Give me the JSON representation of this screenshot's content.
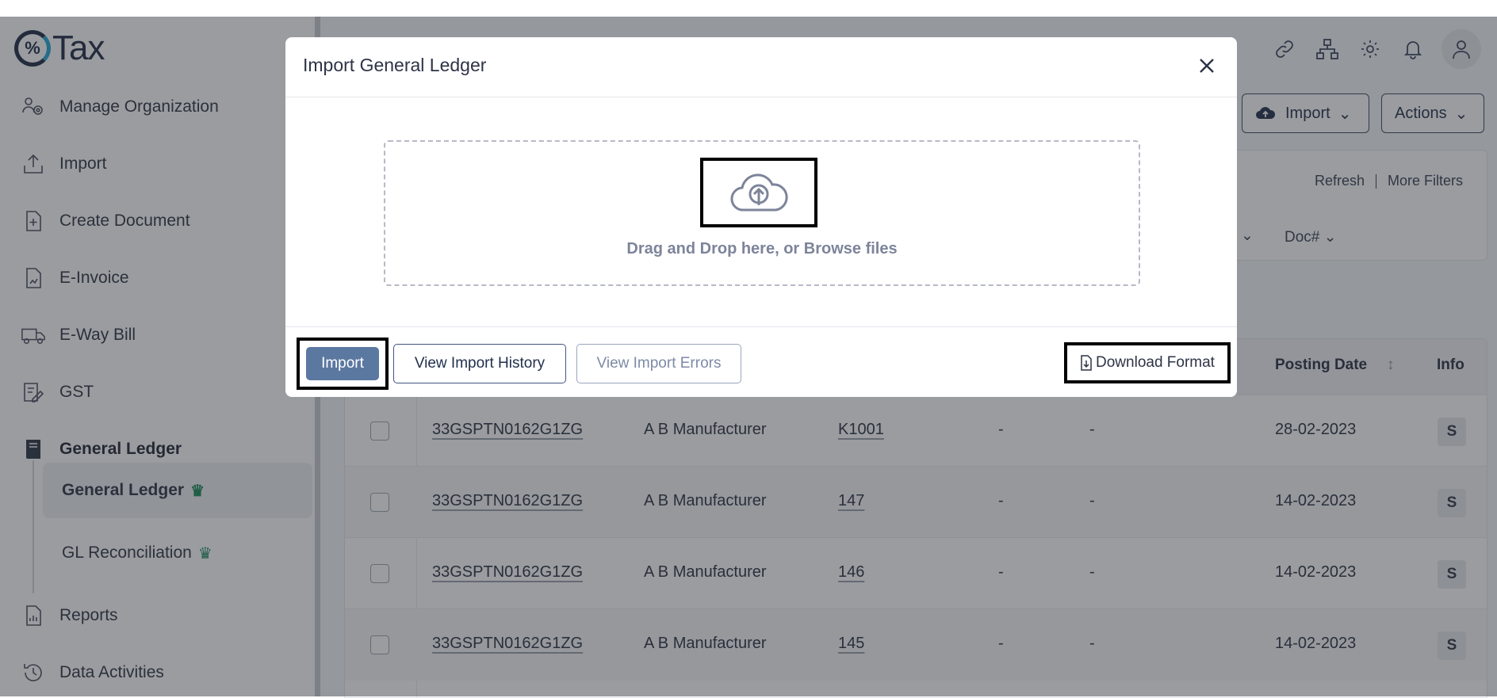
{
  "app": {
    "logo_symbol": "%",
    "logo_text": "Tax"
  },
  "sidebar": {
    "items": [
      {
        "label": "Manage Organization",
        "icon": "organization-icon"
      },
      {
        "label": "Import",
        "icon": "upload-icon"
      },
      {
        "label": "Create Document",
        "icon": "document-plus-icon"
      },
      {
        "label": "E-Invoice",
        "icon": "invoice-icon"
      },
      {
        "label": "E-Way Bill",
        "icon": "truck-icon"
      },
      {
        "label": "GST",
        "icon": "gst-icon"
      },
      {
        "label": "General Ledger",
        "icon": "book-icon"
      },
      {
        "label": "Reports",
        "icon": "report-icon"
      },
      {
        "label": "Data Activities",
        "icon": "history-icon"
      }
    ],
    "sub_items": [
      {
        "label": "General Ledger",
        "badge_icon": "crown-icon"
      },
      {
        "label": "GL Reconciliation",
        "badge_icon": "crown-icon"
      }
    ]
  },
  "toolbar": {
    "import_label": "Import",
    "actions_label": "Actions"
  },
  "filters": {
    "refresh": "Refresh",
    "more_filters": "More Filters",
    "doc_filter": "Doc#"
  },
  "table": {
    "headers": {
      "posting_date": "Posting Date",
      "info": "Info"
    },
    "rows": [
      {
        "gstin": "33GSPTN0162G1ZG",
        "party": "A B Manufacturer",
        "doc": "K1001",
        "c1": "-",
        "c2": "-",
        "date": "28-02-2023",
        "info": "S"
      },
      {
        "gstin": "33GSPTN0162G1ZG",
        "party": "A B Manufacturer",
        "doc": "147",
        "c1": "-",
        "c2": "-",
        "date": "14-02-2023",
        "info": "S"
      },
      {
        "gstin": "33GSPTN0162G1ZG",
        "party": "A B Manufacturer",
        "doc": "146",
        "c1": "-",
        "c2": "-",
        "date": "14-02-2023",
        "info": "S"
      },
      {
        "gstin": "33GSPTN0162G1ZG",
        "party": "A B Manufacturer",
        "doc": "145",
        "c1": "-",
        "c2": "-",
        "date": "14-02-2023",
        "info": "S"
      }
    ]
  },
  "modal": {
    "title": "Import General Ledger",
    "drop_text": "Drag and Drop here, or Browse files",
    "import_button": "Import",
    "view_history_button": "View Import History",
    "view_errors_button": "View Import Errors",
    "download_format": "Download Format"
  },
  "colors": {
    "accent": "#5b78a1",
    "primary_dark": "#22304d",
    "crown": "#1b8a5a",
    "overlay": "rgba(40,44,52,0.47)"
  }
}
